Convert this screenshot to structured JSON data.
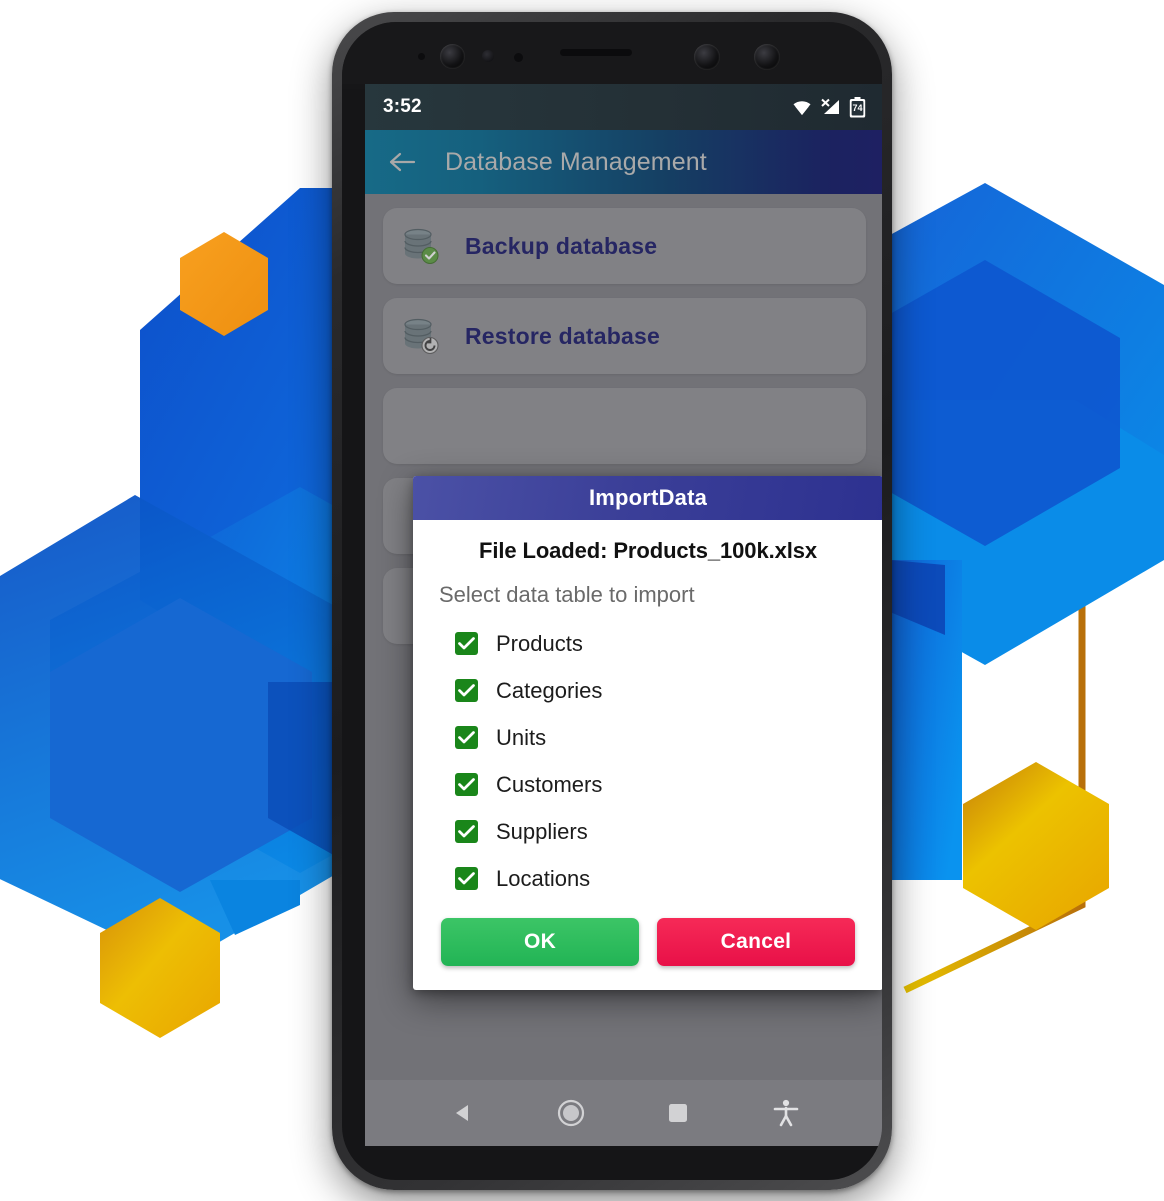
{
  "status_bar": {
    "time": "3:52",
    "battery_level": "74",
    "icons": [
      "wifi-icon",
      "cellular-no-signal-icon",
      "battery-icon"
    ]
  },
  "app_bar": {
    "back_icon": "back-arrow-icon",
    "title": "Database Management"
  },
  "content": {
    "rows": [
      {
        "label": "Backup database",
        "icon": "database-check-icon"
      },
      {
        "label": "Restore database",
        "icon": "database-restore-icon"
      },
      {
        "label": "",
        "icon": ""
      },
      {
        "label": "",
        "icon": ""
      },
      {
        "label": "",
        "icon": ""
      }
    ]
  },
  "dialog": {
    "title": "ImportData",
    "file_loaded": "File Loaded: Products_100k.xlsx",
    "prompt": "Select data table to import",
    "tables": [
      {
        "label": "Products",
        "checked": true
      },
      {
        "label": "Categories",
        "checked": true
      },
      {
        "label": "Units",
        "checked": true
      },
      {
        "label": "Customers",
        "checked": true
      },
      {
        "label": "Suppliers",
        "checked": true
      },
      {
        "label": "Locations",
        "checked": true
      }
    ],
    "ok_label": "OK",
    "cancel_label": "Cancel"
  },
  "nav_bar": {
    "buttons": [
      "back-triangle-icon",
      "home-circle-icon",
      "recents-square-icon",
      "accessibility-icon"
    ]
  },
  "colors": {
    "app_bar_start": "#176a87",
    "app_bar_end": "#1e2062",
    "dialog_header_start": "#4b51a6",
    "dialog_header_end": "#2d3190",
    "checkbox_green": "#1a861a",
    "ok_button": "#22b455",
    "cancel_button": "#e81048",
    "list_label_blue": "#262673",
    "hex_blue_dark": "#0b57c9",
    "hex_blue_light": "#0a8ce8",
    "hex_orange": "#f59b1e",
    "hex_gold": "#e8b500"
  }
}
